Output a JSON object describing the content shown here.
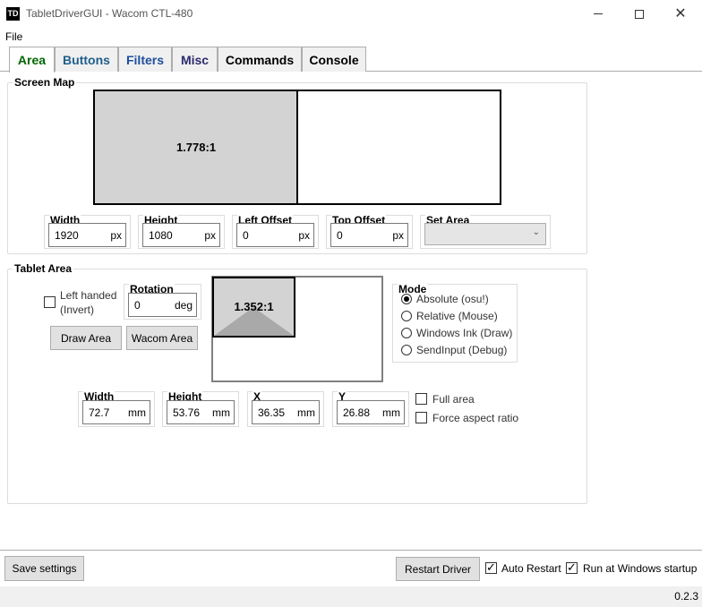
{
  "window": {
    "icon_text": "TD",
    "title": "TabletDriverGUI - Wacom CTL-480"
  },
  "menu": {
    "file": "File"
  },
  "tabs": [
    {
      "label": "Area",
      "color": "#006400"
    },
    {
      "label": "Buttons",
      "color": "#1f5e8c"
    },
    {
      "label": "Filters",
      "color": "#1f4e9c"
    },
    {
      "label": "Misc",
      "color": "#2b2b6e"
    },
    {
      "label": "Commands",
      "color": "#000000"
    },
    {
      "label": "Console",
      "color": "#000000"
    }
  ],
  "screen_map": {
    "title": "Screen Map",
    "ratio": "1.778:1",
    "width_label": "Width",
    "width_value": "1920",
    "width_unit": "px",
    "height_label": "Height",
    "height_value": "1080",
    "height_unit": "px",
    "left_label": "Left Offset",
    "left_value": "0",
    "left_unit": "px",
    "top_label": "Top Offset",
    "top_value": "0",
    "top_unit": "px",
    "set_area_label": "Set Area",
    "set_area_value": ""
  },
  "tablet_area": {
    "title": "Tablet Area",
    "left_handed_line1": "Left handed",
    "left_handed_line2": "(Invert)",
    "rotation_label": "Rotation",
    "rotation_value": "0",
    "rotation_unit": "deg",
    "draw_area": "Draw Area",
    "wacom_area": "Wacom Area",
    "ratio": "1.352:1",
    "width_label": "Width",
    "width_value": "72.7",
    "width_unit": "mm",
    "height_label": "Height",
    "height_value": "53.76",
    "height_unit": "mm",
    "x_label": "X",
    "x_value": "36.35",
    "x_unit": "mm",
    "y_label": "Y",
    "y_value": "26.88",
    "y_unit": "mm",
    "full_area": "Full area",
    "force_aspect": "Force aspect ratio"
  },
  "mode": {
    "title": "Mode",
    "options": [
      "Absolute (osu!)",
      "Relative (Mouse)",
      "Windows Ink (Draw)",
      "SendInput (Debug)"
    ],
    "selected_index": 0
  },
  "bottom": {
    "save_settings": "Save settings",
    "restart_driver": "Restart Driver",
    "auto_restart": "Auto Restart",
    "run_startup": "Run at Windows startup",
    "version": "0.2.3"
  }
}
